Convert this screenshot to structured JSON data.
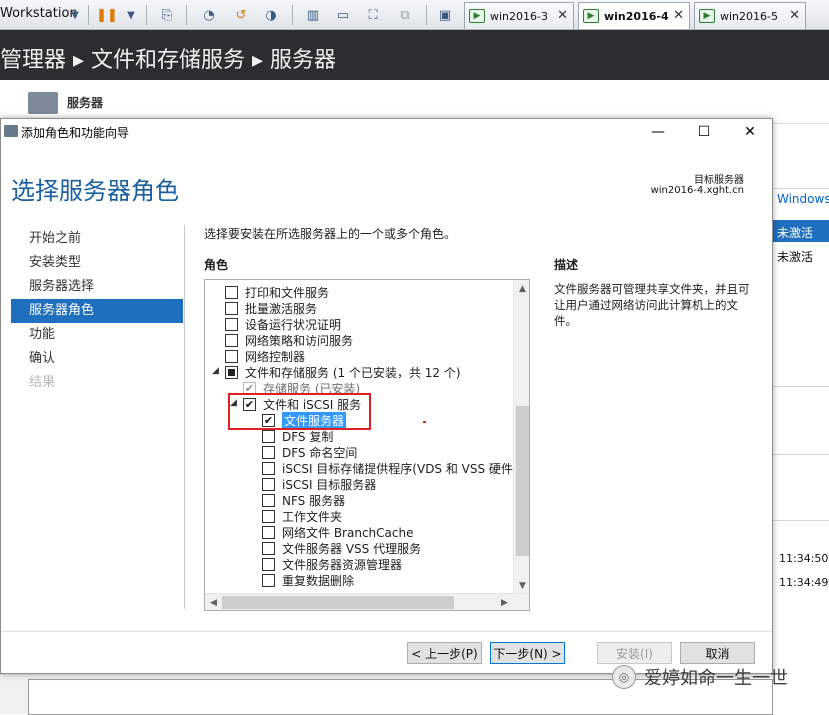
{
  "vmware": {
    "app_title": "Workstation",
    "tabs": [
      {
        "label": "win2016-3",
        "active": false
      },
      {
        "label": "win2016-4",
        "active": true
      },
      {
        "label": "win2016-5",
        "active": false
      }
    ],
    "icons": [
      "dropdown-icon",
      "pause-icon",
      "send-ctrl-alt-del-icon",
      "snapshot-icon",
      "revert-snapshot-icon",
      "snapshot-manager-icon",
      "library-view-icon",
      "console-view-icon",
      "full-screen-icon",
      "unity-icon",
      "vm-tab-icon"
    ]
  },
  "server_manager": {
    "breadcrumb": "管理器 ▸ 文件和存储服务 ▸ 服务器",
    "band_label": "服务器",
    "right_panel": {
      "windows_label": "Windows",
      "status_selected": "未激活",
      "status_second": "未激活",
      "time1": "11:34:50",
      "time2": "11:34:49"
    }
  },
  "wizard": {
    "window_title": "添加角色和功能向导",
    "controls": {
      "minimize": "—",
      "maximize": "☐",
      "close": "✕"
    },
    "heading": "选择服务器角色",
    "target_label": "目标服务器",
    "target_value": "win2016-4.xght.cn",
    "steps": [
      {
        "label": "开始之前",
        "state": "normal"
      },
      {
        "label": "安装类型",
        "state": "normal"
      },
      {
        "label": "服务器选择",
        "state": "normal"
      },
      {
        "label": "服务器角色",
        "state": "active"
      },
      {
        "label": "功能",
        "state": "normal"
      },
      {
        "label": "确认",
        "state": "normal"
      },
      {
        "label": "结果",
        "state": "disabled"
      }
    ],
    "instruction": "选择要安装在所选服务器上的一个或多个角色。",
    "roles_label": "角色",
    "roles": [
      {
        "label": "打印和文件服务",
        "check": "none",
        "indent": 0
      },
      {
        "label": "批量激活服务",
        "check": "none",
        "indent": 0
      },
      {
        "label": "设备运行状况证明",
        "check": "none",
        "indent": 0
      },
      {
        "label": "网络策略和访问服务",
        "check": "none",
        "indent": 0
      },
      {
        "label": "网络控制器",
        "check": "none",
        "indent": 0
      },
      {
        "label": "文件和存储服务 (1 个已安装，共 12 个)",
        "check": "indeterminate",
        "indent": 0,
        "expander": "◢"
      },
      {
        "label": "存储服务 (已安装)",
        "check": "checked-disabled",
        "indent": 1
      },
      {
        "label": "文件和 iSCSI 服务",
        "check": "checked",
        "indent": 1,
        "expander": "◢"
      },
      {
        "label": "文件服务器",
        "check": "checked",
        "indent": 2,
        "selected": true
      },
      {
        "label": "DFS 复制",
        "check": "none",
        "indent": 2
      },
      {
        "label": "DFS 命名空间",
        "check": "none",
        "indent": 2
      },
      {
        "label": "iSCSI 目标存储提供程序(VDS 和 VSS 硬件",
        "check": "none",
        "indent": 2
      },
      {
        "label": "iSCSI 目标服务器",
        "check": "none",
        "indent": 2
      },
      {
        "label": "NFS 服务器",
        "check": "none",
        "indent": 2
      },
      {
        "label": "工作文件夹",
        "check": "none",
        "indent": 2
      },
      {
        "label": "网络文件 BranchCache",
        "check": "none",
        "indent": 2
      },
      {
        "label": "文件服务器 VSS 代理服务",
        "check": "none",
        "indent": 2
      },
      {
        "label": "文件服务器资源管理器",
        "check": "none",
        "indent": 2
      },
      {
        "label": "重复数据删除",
        "check": "none",
        "indent": 2
      }
    ],
    "description_label": "描述",
    "description_text": "文件服务器可管理共享文件夹，并且可让用户通过网络访问此计算机上的文件。",
    "buttons": {
      "previous": "< 上一步(P)",
      "next": "下一步(N) >",
      "install": "安装(I)",
      "cancel": "取消"
    },
    "highlight_color": "#e02020",
    "accent_color": "#1f6fbf"
  },
  "watermark": {
    "text": "爱婷如命一生一世"
  }
}
